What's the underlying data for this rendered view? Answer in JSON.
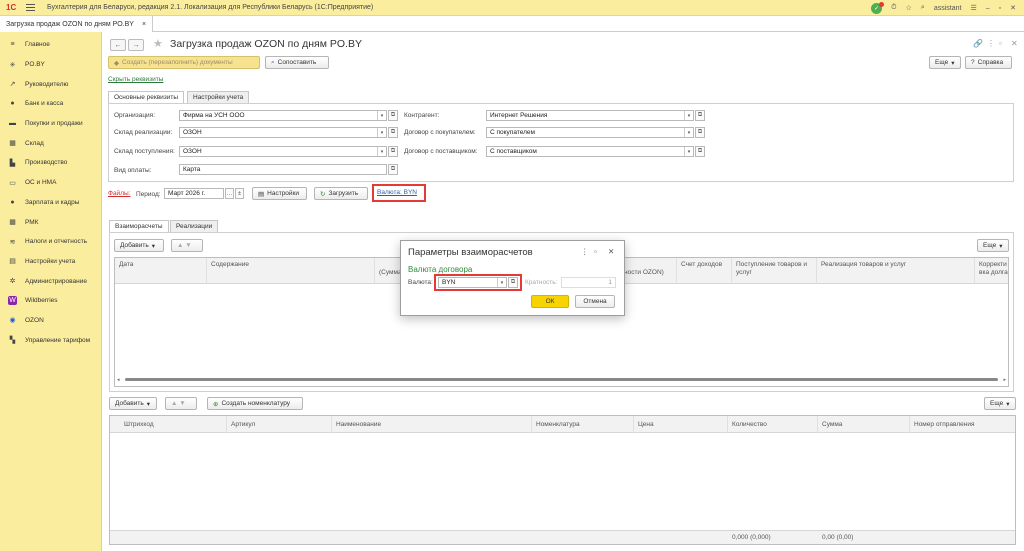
{
  "app": {
    "logo_text": "1С",
    "title": "Бухгалтерия для Беларуси, редакция 2.1. Локализация для Республики Беларусь (1С:Предприятие)",
    "user": "assistant"
  },
  "doc_tab": {
    "label": "Загрузка продаж OZON по дням PO.BY",
    "close": "×"
  },
  "sidebar": {
    "items": [
      {
        "label": "Главное",
        "icon": "≡"
      },
      {
        "label": "PO.BY",
        "icon": "✳"
      },
      {
        "label": "Руководителю",
        "icon": "↗"
      },
      {
        "label": "Банк и касса",
        "icon": "●"
      },
      {
        "label": "Покупки и продажи",
        "icon": "▬"
      },
      {
        "label": "Склад",
        "icon": "▦"
      },
      {
        "label": "Производство",
        "icon": "▙"
      },
      {
        "label": "ОС и НМА",
        "icon": "▭"
      },
      {
        "label": "Зарплата и кадры",
        "icon": "●"
      },
      {
        "label": "РМК",
        "icon": "▦"
      },
      {
        "label": "Налоги и отчетность",
        "icon": "≋"
      },
      {
        "label": "Настройки учета",
        "icon": "▤"
      },
      {
        "label": "Администрирование",
        "icon": "✲"
      },
      {
        "label": "Wildberries",
        "icon": "W"
      },
      {
        "label": "OZON",
        "icon": "◉"
      },
      {
        "label": "Управление тарифом",
        "icon": "▚"
      }
    ]
  },
  "header": {
    "back": "←",
    "forward": "→",
    "title": "Загрузка продаж OZON по дням PO.BY"
  },
  "toolbar": {
    "create_docs": "Создать (перезаполнить) документы",
    "compare": "Сопоставить",
    "more": "Еще",
    "help": "Справка"
  },
  "hide_details_link": "Скрыть реквизиты",
  "tabs": {
    "main": "Основные реквизиты",
    "settings": "Настройки учета"
  },
  "form": {
    "org_label": "Организация:",
    "org_value": "Фирма на УСН ООО",
    "warehouse_sale_label": "Склад реализации:",
    "warehouse_sale_value": "ОЗОН",
    "warehouse_receipt_label": "Склад поступления:",
    "warehouse_receipt_value": "ОЗОН",
    "payment_label": "Вид оплаты:",
    "payment_value": "Карта",
    "counterparty_label": "Контрагент:",
    "counterparty_value": "Интернет Решения",
    "buyer_contract_label": "Договор с покупателем:",
    "buyer_contract_value": "С покупателем",
    "supplier_contract_label": "Договор с поставщиком:",
    "supplier_contract_value": "С поставщиком"
  },
  "period_row": {
    "files_link": "Файлы:",
    "period_label": "Период:",
    "period_value": "Март 2026 г.",
    "settings_btn": "Настройки",
    "load_btn": "Загрузить",
    "currency_link": "Валюта: BYN"
  },
  "lower_tabs": {
    "settlements": "Взаиморасчеты",
    "sales": "Реализации"
  },
  "table1": {
    "add_btn": "Добавить",
    "more_btn": "Еще",
    "columns": [
      "Дата",
      "Содержание",
      "(Сумма",
      "ности OZON)",
      "Счет доходов",
      "Поступление товаров и услуг",
      "Реализация товаров и услуг",
      "Корректи вка долга"
    ]
  },
  "table2": {
    "add_btn": "Добавить",
    "create_nomenclature_btn": "Создать номенклатуру",
    "more_btn": "Еще",
    "columns": [
      "Штрихкод",
      "Артикул",
      "Наименование",
      "Номенклатура",
      "Цена",
      "Количество",
      "Сумма",
      "Номер отправления"
    ],
    "footer_qty": "0,000 (0,000)",
    "footer_sum": "0,00 (0,00)"
  },
  "dialog": {
    "title": "Параметры взаиморасчетов",
    "section": "Валюта договора",
    "currency_label": "Валюта:",
    "currency_value": "BYN",
    "multiplicity_label": "Кратность:",
    "multiplicity_value": "1",
    "ok": "ОК",
    "cancel": "Отмена"
  },
  "colors": {
    "sidebar_bg": "#fbed9e",
    "accent_green": "#2e8b3f",
    "highlight_red": "#e53935",
    "ok_yellow": "#f7d300"
  }
}
